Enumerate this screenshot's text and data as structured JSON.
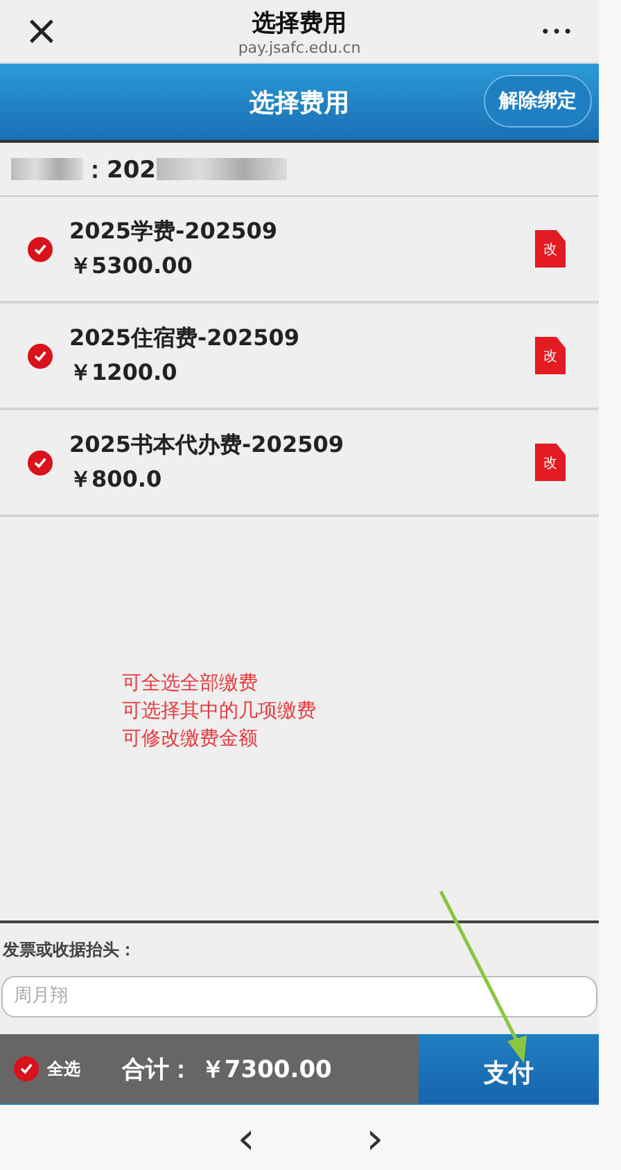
{
  "browser_bar": {
    "close": "×",
    "title": "选择费用",
    "url": "pay.jsafc.edu.cn",
    "more": "•••"
  },
  "header": {
    "title": "选择费用",
    "unbind_button": "解除绑定"
  },
  "student": {
    "id_prefix": "：202"
  },
  "fees": [
    {
      "name": "2025学费-202509",
      "amount": "￥5300.00",
      "checked": true,
      "edit_icon": "改"
    },
    {
      "name": "2025住宿费-202509",
      "amount": "￥1200.0",
      "checked": true,
      "edit_icon": "改"
    },
    {
      "name": "2025书本代办费-202509",
      "amount": "￥800.0",
      "checked": true,
      "edit_icon": "改"
    }
  ],
  "annotation": [
    "可全选全部缴费",
    "可选择其中的几项缴费",
    "可修改缴费金额"
  ],
  "invoice": {
    "label": "发票或收据抬头：",
    "placeholder": "周月翔"
  },
  "footer": {
    "select_all": {
      "label": "全选",
      "checked": true
    },
    "total": "合计： ￥7300.00",
    "pay_button": "支付"
  },
  "nav": {
    "back": "‹",
    "forward": "›"
  }
}
